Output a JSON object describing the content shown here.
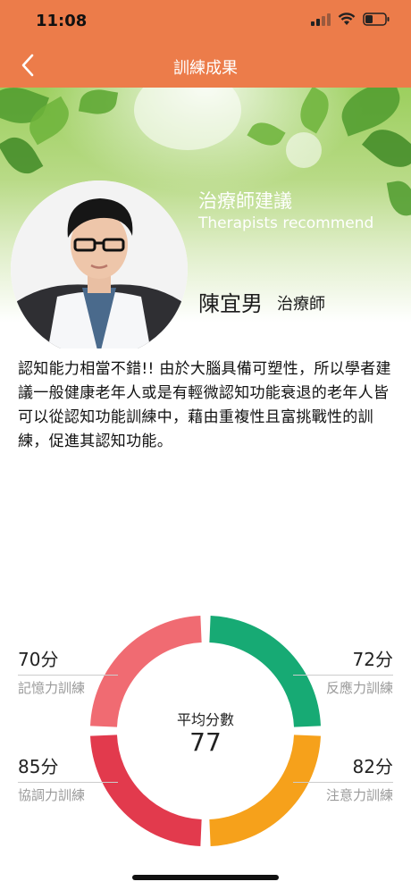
{
  "status": {
    "time": "11:08"
  },
  "nav": {
    "title": "訓練成果"
  },
  "hero": {
    "rec_title": "治療師建議",
    "rec_subtitle": "Therapists recommend",
    "therapist_name": "陳宜男",
    "therapist_role": "治療師"
  },
  "message": "認知能力相當不錯!! 由於大腦具備可塑性，所以學者建議一般健康老年人或是有輕微認知功能衰退的老年人皆可以從認知功能訓練中，藉由重複性且富挑戰性的訓練，促進其認知功能。",
  "scores": {
    "memory": {
      "value": "70分",
      "label": "記憶力訓練",
      "color": "#f06b72"
    },
    "reaction": {
      "value": "72分",
      "label": "反應力訓練",
      "color": "#17aa74"
    },
    "coordination": {
      "value": "85分",
      "label": "協調力訓練",
      "color": "#e23a4d"
    },
    "attention": {
      "value": "82分",
      "label": "注意力訓練",
      "color": "#f6a11b"
    }
  },
  "average": {
    "label": "平均分數",
    "value": "77"
  },
  "colors": {
    "header": "#ec7c4a"
  }
}
